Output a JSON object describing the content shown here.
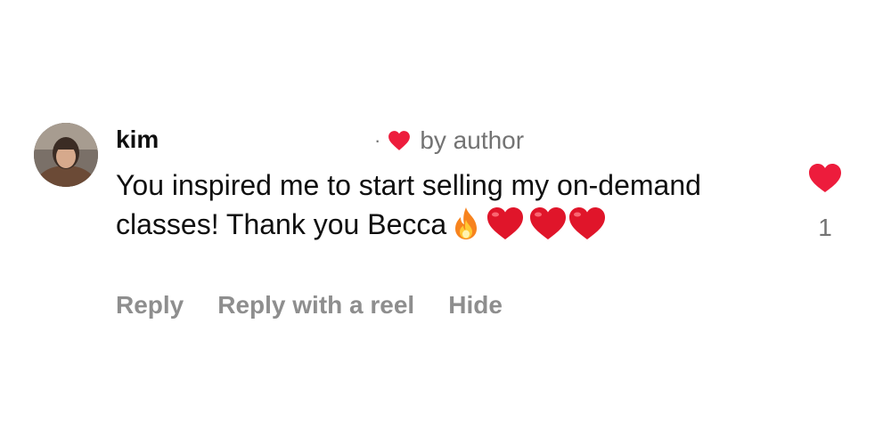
{
  "comment": {
    "author": "kim",
    "liked_by_label": "by author",
    "liked_by_separator": "·",
    "text": "You inspired me to start selling my on-demand classes! Thank you Becca",
    "trailing_emojis": [
      "fire",
      "red-heart",
      "red-heart",
      "red-heart"
    ],
    "like_count": "1",
    "liked": true
  },
  "actions": {
    "reply": "Reply",
    "reply_with_reel": "Reply with a reel",
    "hide": "Hide"
  },
  "colors": {
    "heart": "#ed1c3c",
    "muted_text": "#737373",
    "action_text": "#8e8e8e",
    "primary_text": "#0f0f0f"
  },
  "icons": {
    "avatar": "user-photo",
    "author_like": "heart-icon",
    "like_button": "heart-filled-icon"
  }
}
